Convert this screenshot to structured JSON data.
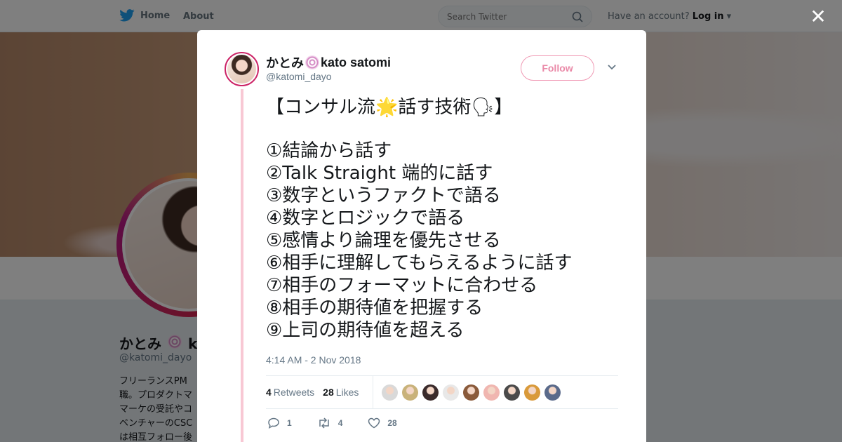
{
  "topbar": {
    "home_label": "Home",
    "about_label": "About",
    "search_placeholder": "Search Twitter",
    "account_prompt": "Have an account?",
    "login_label": "Log in"
  },
  "profile": {
    "name": "かとみ",
    "name_tail": "ka",
    "handle": "@katomi_dayo",
    "bio_lines": [
      "フリーランスPM",
      "職。プロダクトマ",
      "マーケの受託やコ",
      "ベンチャーのCSC",
      "は相互フォロー後"
    ]
  },
  "tweet": {
    "author_name_left": "かとみ",
    "author_name_right": "kato satomi",
    "author_handle": "@katomi_dayo",
    "follow_label": "Follow",
    "text_lines": [
      "【コンサル流🌟話す技術🗣】",
      "",
      "①結論から話す",
      "②Talk Straight 端的に話す",
      "③数字というファクトで語る",
      "④数字とロジックで語る",
      "⑤感情より論理を優先させる",
      "⑥相手に理解してもらえるように話す",
      "⑦相手のフォーマットに合わせる",
      "⑧相手の期待値を把握する",
      "⑨上司の期待値を超える"
    ],
    "timestamp": "4:14 AM - 2 Nov 2018",
    "retweets_count": "4",
    "retweets_label": "Retweets",
    "likes_count": "28",
    "likes_label": "Likes",
    "liker_colors": [
      "#d9d9d9",
      "#c9b27a",
      "#3a2b2b",
      "#e8e8e8",
      "#8a5a3a",
      "#f0b6b0",
      "#4a4a4a",
      "#d99a3a",
      "#5a6a8a"
    ],
    "reply_count": "1",
    "retweet_action_count": "4",
    "like_action_count": "28"
  },
  "colors": {
    "accent_pink": "#ea8aa8",
    "thread_line": "#f8c8d4",
    "twitter_blue": "#1da1f2"
  }
}
